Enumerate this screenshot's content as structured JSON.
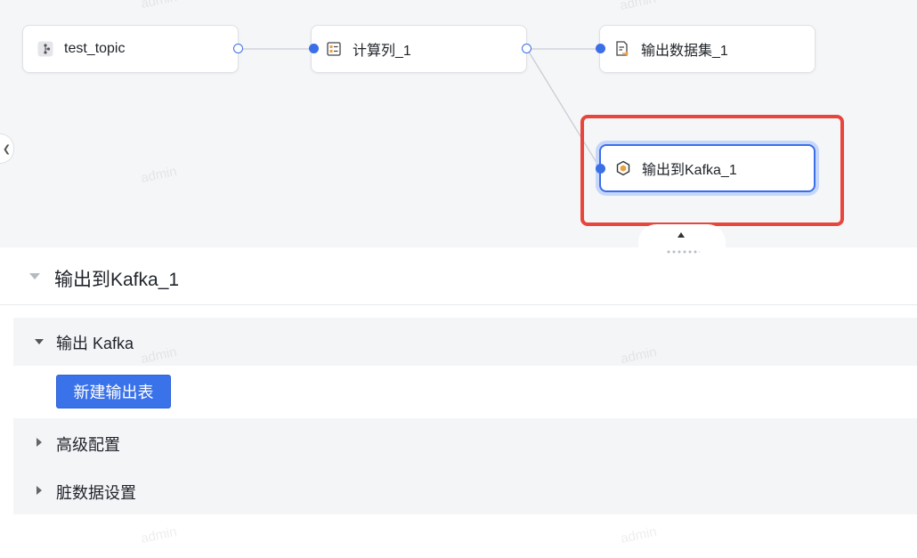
{
  "canvas": {
    "nodes": [
      {
        "label": "test_topic",
        "icon": "kafka-source-icon"
      },
      {
        "label": "计算列_1",
        "icon": "compute-column-icon"
      },
      {
        "label": "输出数据集_1",
        "icon": "output-dataset-icon"
      },
      {
        "label": "输出到Kafka_1",
        "icon": "kafka-output-icon"
      }
    ],
    "watermark": "admin",
    "colors": {
      "accent": "#3a6fe8",
      "highlight": "#e8453c"
    }
  },
  "panel": {
    "title": "输出到Kafka_1",
    "sections": [
      {
        "label": "输出 Kafka",
        "expanded": true,
        "button_label": "新建输出表"
      },
      {
        "label": "高级配置",
        "expanded": false
      },
      {
        "label": "脏数据设置",
        "expanded": false
      }
    ]
  }
}
